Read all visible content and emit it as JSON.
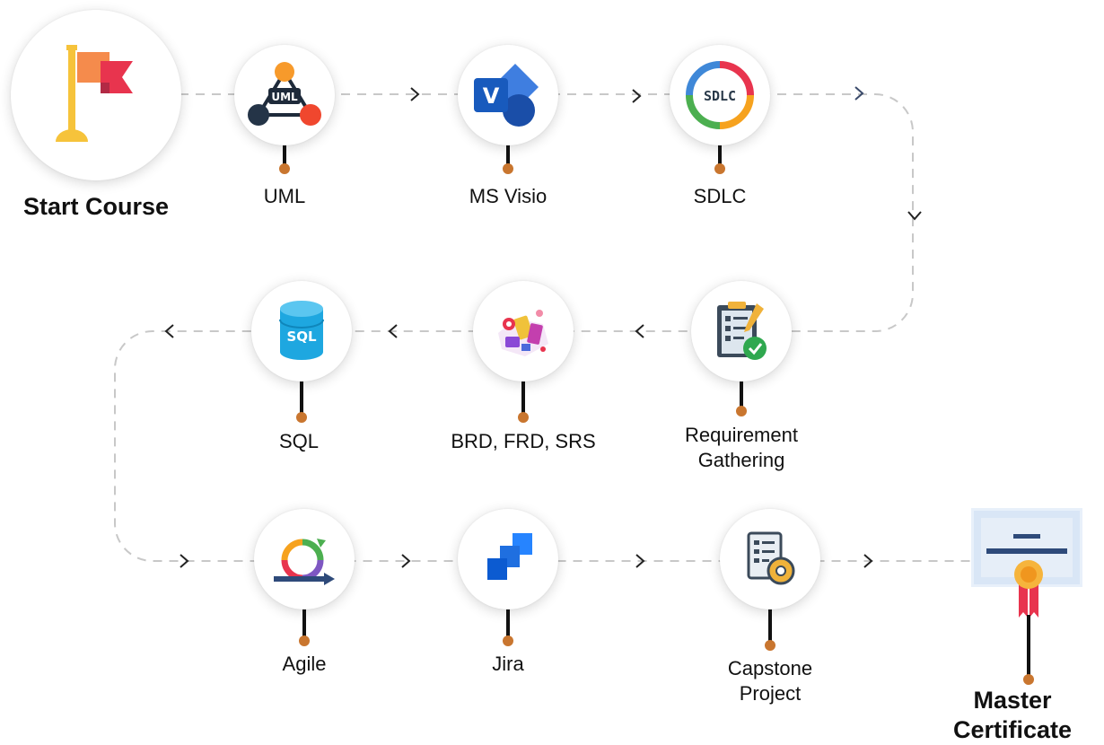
{
  "start": {
    "label": "Start Course",
    "icon": "flag-icon"
  },
  "row1": [
    {
      "label": "UML",
      "icon": "uml-icon",
      "icon_text": "UML"
    },
    {
      "label": "MS Visio",
      "icon": "visio-icon",
      "icon_text": "V"
    },
    {
      "label": "SDLC",
      "icon": "sdlc-icon",
      "icon_text": "SDLC"
    }
  ],
  "row2": [
    {
      "label": "Requirement\nGathering",
      "icon": "clipboard-checklist-icon"
    },
    {
      "label": "BRD, FRD, SRS",
      "icon": "documents-illustration-icon"
    },
    {
      "label": "SQL",
      "icon": "database-icon",
      "icon_text": "SQL"
    }
  ],
  "row3": [
    {
      "label": "Agile",
      "icon": "agile-cycle-icon"
    },
    {
      "label": "Jira",
      "icon": "jira-icon"
    },
    {
      "label": "Capstone\nProject",
      "icon": "document-gear-icon"
    }
  ],
  "finish": {
    "label": "Master\nCertificate",
    "icon": "certificate-icon"
  },
  "colors": {
    "accent_dot": "#c9762f",
    "stem": "#111111",
    "dashed_line": "#c8c8c8",
    "chevron": "#222222"
  }
}
